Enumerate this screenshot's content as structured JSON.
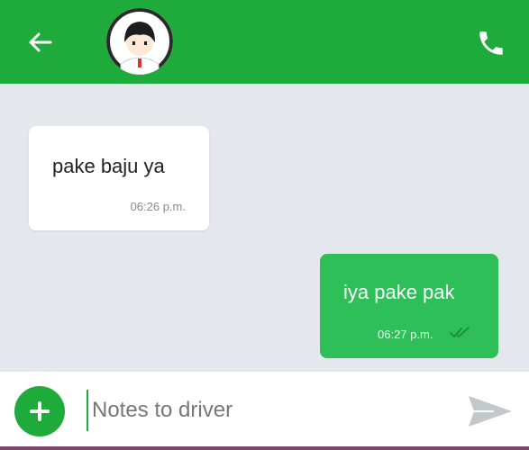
{
  "colors": {
    "header": "#1faa3c",
    "chat_background": "#e4e8ec",
    "outgoing_bubble": "#2fbf58",
    "incoming_bubble": "#ffffff"
  },
  "header": {
    "back_icon": "arrow-left-icon",
    "avatar_icon": "driver-avatar",
    "call_icon": "phone-icon"
  },
  "messages": [
    {
      "direction": "incoming",
      "text": "pake baju ya",
      "time": "06:26 p.m."
    },
    {
      "direction": "outgoing",
      "text": "iya pake pak",
      "time": "06:27 p.m.",
      "status_icon": "double-check-icon"
    }
  ],
  "composer": {
    "add_icon": "plus-icon",
    "placeholder": "Notes to driver",
    "send_icon": "send-icon"
  }
}
